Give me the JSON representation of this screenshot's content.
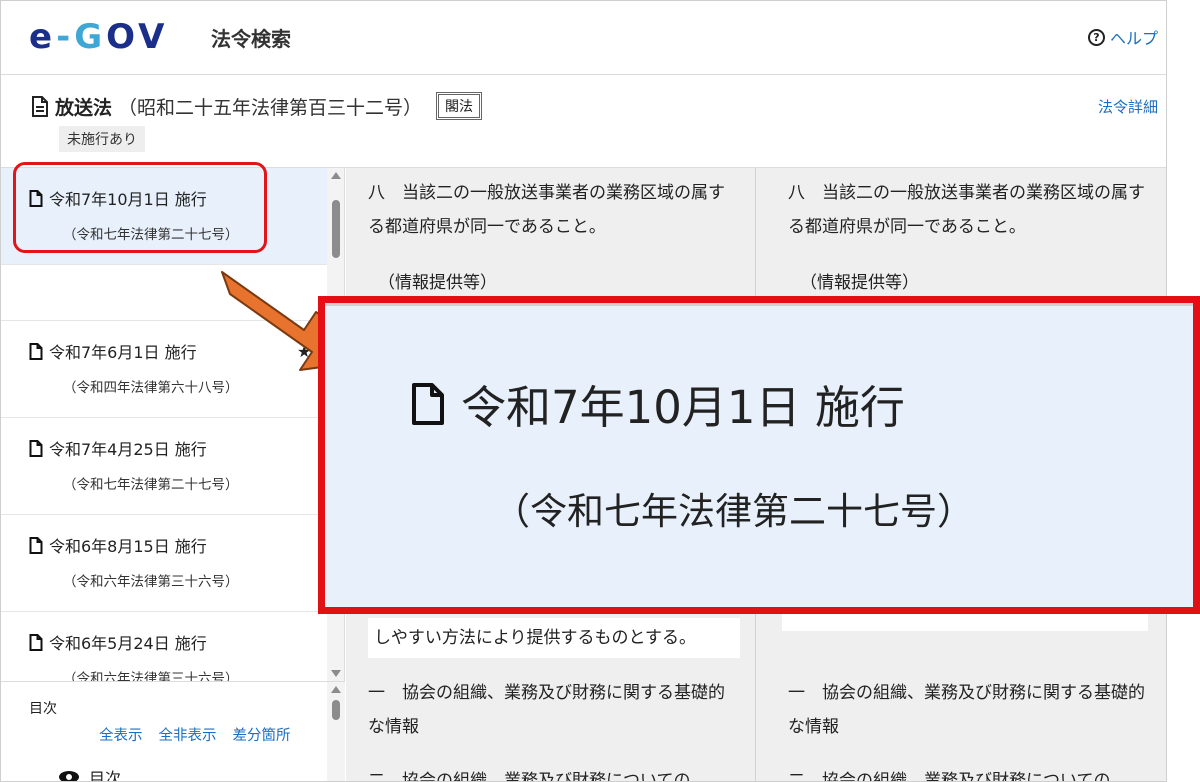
{
  "header": {
    "logo": "e-GOV",
    "title": "法令検索",
    "help_label": "ヘルプ"
  },
  "law": {
    "name": "放送法",
    "number": "（昭和二十五年法律第百三十二号）",
    "badge": "閣法",
    "status_tag": "未施行あり",
    "detail_link": "法令詳細"
  },
  "revisions": [
    {
      "date": "令和7年10月1日 施行",
      "law": "（令和七年法律第二十七号）",
      "active": true
    },
    {
      "date": "令和7年6月1日 施行",
      "law": "（令和四年法律第六十八号）",
      "starred": true
    },
    {
      "date": "令和7年4月25日 施行",
      "law": "（令和七年法律第二十七号）"
    },
    {
      "date": "令和6年8月15日 施行",
      "law": "（令和六年法律第三十六号）"
    },
    {
      "date": "令和6年5月24日 施行",
      "law": "（令和六年法律第三十六号）"
    }
  ],
  "toc": {
    "label": "目次",
    "show_all": "全表示",
    "hide_all": "全非表示",
    "diff": "差分箇所",
    "item": "目次"
  },
  "columns": {
    "left": {
      "item_eight": "八　当該二の一般放送事業者の業務区域の属する都道府県が同一であること。",
      "info_heading": "（情報提供等）",
      "white_text": "しやすい方法により提供するものとする。",
      "item_one": "一　協会の組織、業務及び財務に関する基礎的な情報",
      "item_two": "二　協会の組織、業務及び財務についての"
    },
    "right": {
      "item_eight": "八　当該二の一般放送事業者の業務区域の属する都道府県が同一であること。",
      "info_heading": "（情報提供等）",
      "item_one": "一　協会の組織、業務及び財務に関する基礎的な情報",
      "item_two": "二　協会の組織、業務及び財務についての"
    }
  },
  "zoom": {
    "date": "令和7年10月1日 施行",
    "law": "（令和七年法律第二十七号）"
  },
  "colors": {
    "highlight_red": "#e30f14",
    "arrow_orange": "#e8732e",
    "active_bg": "#e8f1fb",
    "link_blue": "#1a6fc4"
  }
}
